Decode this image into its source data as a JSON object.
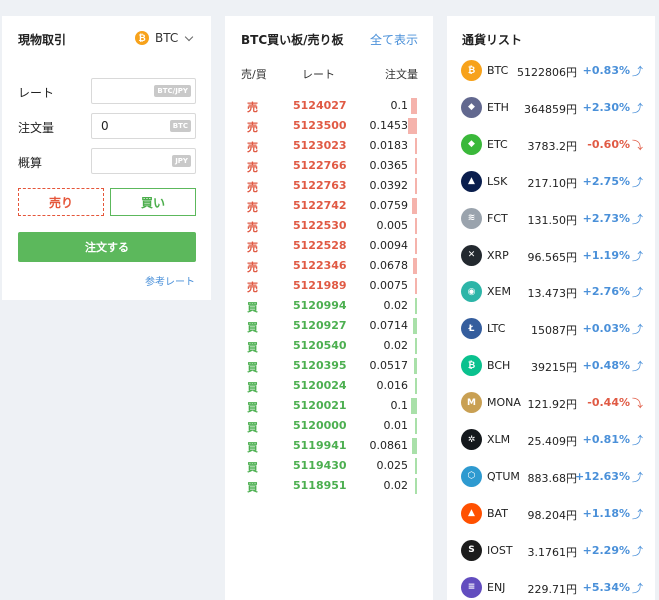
{
  "spot": {
    "title": "現物取引",
    "coin_icon": "bitcoin-icon",
    "coin_icon_glyph": "₿",
    "coin": "BTC",
    "rate_label": "レート",
    "rate_value": "",
    "rate_unit": "BTC/JPY",
    "qty_label": "注文量",
    "qty_value": "0",
    "qty_unit": "BTC",
    "est_label": "概算",
    "est_value": "",
    "est_unit": "JPY",
    "sell_label": "売り",
    "buy_label": "買い",
    "order_label": "注文する",
    "ref_link": "参考レート"
  },
  "book": {
    "title": "BTC買い板/売り板",
    "show_all": "全て表示",
    "headers": [
      "売/買",
      "レート",
      "注文量"
    ],
    "rows": [
      {
        "side": "売",
        "rate": "5124027",
        "qty": "0.1",
        "type": "sell",
        "depth": 0.1
      },
      {
        "side": "売",
        "rate": "5123500",
        "qty": "0.1453",
        "type": "sell",
        "depth": 0.1453
      },
      {
        "side": "売",
        "rate": "5123023",
        "qty": "0.0183",
        "type": "sell",
        "depth": 0.0183
      },
      {
        "side": "売",
        "rate": "5122766",
        "qty": "0.0365",
        "type": "sell",
        "depth": 0.0365
      },
      {
        "side": "売",
        "rate": "5122763",
        "qty": "0.0392",
        "type": "sell",
        "depth": 0.0392
      },
      {
        "side": "売",
        "rate": "5122742",
        "qty": "0.0759",
        "type": "sell",
        "depth": 0.0759
      },
      {
        "side": "売",
        "rate": "5122530",
        "qty": "0.005",
        "type": "sell",
        "depth": 0.005
      },
      {
        "side": "売",
        "rate": "5122528",
        "qty": "0.0094",
        "type": "sell",
        "depth": 0.0094
      },
      {
        "side": "売",
        "rate": "5122346",
        "qty": "0.0678",
        "type": "sell",
        "depth": 0.0678
      },
      {
        "side": "売",
        "rate": "5121989",
        "qty": "0.0075",
        "type": "sell",
        "depth": 0.0075
      },
      {
        "side": "買",
        "rate": "5120994",
        "qty": "0.02",
        "type": "buy",
        "depth": 0.02
      },
      {
        "side": "買",
        "rate": "5120927",
        "qty": "0.0714",
        "type": "buy",
        "depth": 0.0714
      },
      {
        "side": "買",
        "rate": "5120540",
        "qty": "0.02",
        "type": "buy",
        "depth": 0.02
      },
      {
        "side": "買",
        "rate": "5120395",
        "qty": "0.0517",
        "type": "buy",
        "depth": 0.0517
      },
      {
        "side": "買",
        "rate": "5120024",
        "qty": "0.016",
        "type": "buy",
        "depth": 0.016
      },
      {
        "side": "買",
        "rate": "5120021",
        "qty": "0.1",
        "type": "buy",
        "depth": 0.1
      },
      {
        "side": "買",
        "rate": "5120000",
        "qty": "0.01",
        "type": "buy",
        "depth": 0.01
      },
      {
        "side": "買",
        "rate": "5119941",
        "qty": "0.0861",
        "type": "buy",
        "depth": 0.0861
      },
      {
        "side": "買",
        "rate": "5119430",
        "qty": "0.025",
        "type": "buy",
        "depth": 0.025
      },
      {
        "side": "買",
        "rate": "5118951",
        "qty": "0.02",
        "type": "buy",
        "depth": 0.02
      }
    ]
  },
  "coins": {
    "title": "通貨リスト",
    "items": [
      {
        "sym": "BTC",
        "price": "5122806円",
        "chg": "+0.83%",
        "dir": "up",
        "icon": "bitcoin-icon",
        "glyph": "₿",
        "color": "#f7a21b"
      },
      {
        "sym": "ETH",
        "price": "364859円",
        "chg": "+2.30%",
        "dir": "up",
        "icon": "ethereum-icon",
        "glyph": "◆",
        "color": "#62688f"
      },
      {
        "sym": "ETC",
        "price": "3783.2円",
        "chg": "-0.60%",
        "dir": "down",
        "icon": "ethereum-classic-icon",
        "glyph": "◆",
        "color": "#3ab83a"
      },
      {
        "sym": "LSK",
        "price": "217.10円",
        "chg": "+2.75%",
        "dir": "up",
        "icon": "lisk-icon",
        "glyph": "▲",
        "color": "#0a1e4d"
      },
      {
        "sym": "FCT",
        "price": "131.50円",
        "chg": "+2.73%",
        "dir": "up",
        "icon": "factom-icon",
        "glyph": "≋",
        "color": "#9aa3ad"
      },
      {
        "sym": "XRP",
        "price": "96.565円",
        "chg": "+1.19%",
        "dir": "up",
        "icon": "ripple-icon",
        "glyph": "✕",
        "color": "#23292f"
      },
      {
        "sym": "XEM",
        "price": "13.473円",
        "chg": "+2.76%",
        "dir": "up",
        "icon": "nem-icon",
        "glyph": "◉",
        "color": "#2db5a8"
      },
      {
        "sym": "LTC",
        "price": "15087円",
        "chg": "+0.03%",
        "dir": "up",
        "icon": "litecoin-icon",
        "glyph": "Ł",
        "color": "#345d9d"
      },
      {
        "sym": "BCH",
        "price": "39215円",
        "chg": "+0.48%",
        "dir": "up",
        "icon": "bitcoin-cash-icon",
        "glyph": "₿",
        "color": "#0ac18e"
      },
      {
        "sym": "MONA",
        "price": "121.92円",
        "chg": "-0.44%",
        "dir": "down",
        "icon": "monacoin-icon",
        "glyph": "M",
        "color": "#c9a053"
      },
      {
        "sym": "XLM",
        "price": "25.409円",
        "chg": "+0.81%",
        "dir": "up",
        "icon": "stellar-icon",
        "glyph": "✲",
        "color": "#14181c"
      },
      {
        "sym": "QTUM",
        "price": "883.68円",
        "chg": "+12.63%",
        "dir": "up",
        "icon": "qtum-icon",
        "glyph": "⬡",
        "color": "#2e9ad0"
      },
      {
        "sym": "BAT",
        "price": "98.204円",
        "chg": "+1.18%",
        "dir": "up",
        "icon": "bat-icon",
        "glyph": "▲",
        "color": "#ff5000"
      },
      {
        "sym": "IOST",
        "price": "3.1761円",
        "chg": "+2.29%",
        "dir": "up",
        "icon": "iost-icon",
        "glyph": "S",
        "color": "#1c1c1c"
      },
      {
        "sym": "ENJ",
        "price": "229.71円",
        "chg": "+5.34%",
        "dir": "up",
        "icon": "enjin-icon",
        "glyph": "≡",
        "color": "#624dbf"
      }
    ]
  },
  "colors": {
    "sell": "#e05a44",
    "buy": "#4caf50",
    "accent_green": "#5cb85c",
    "link": "#4a90d9"
  }
}
